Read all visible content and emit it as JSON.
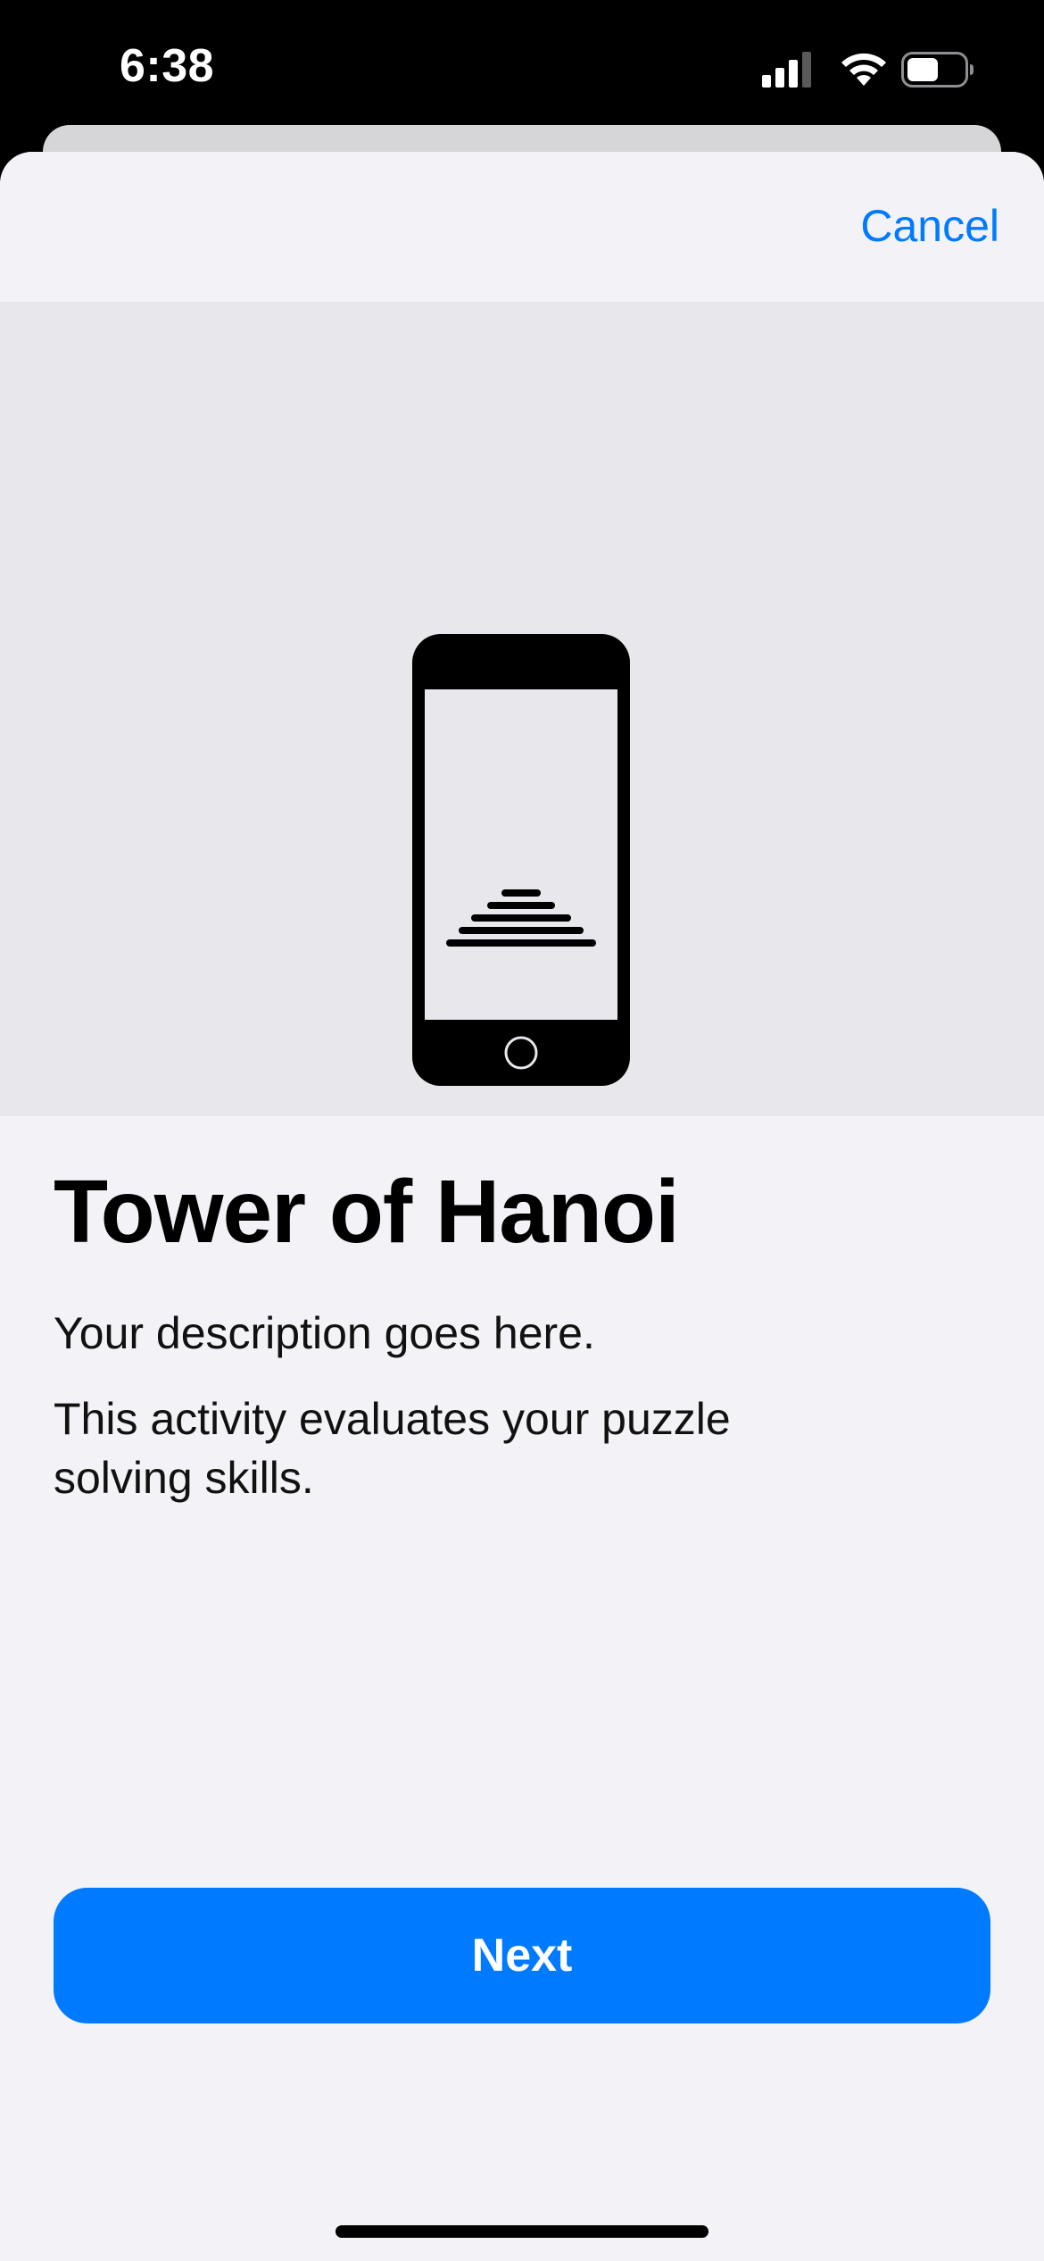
{
  "status_bar": {
    "time": "6:38"
  },
  "nav": {
    "cancel_label": "Cancel"
  },
  "hero": {
    "illustration_icon": "phone-tower-of-hanoi-icon"
  },
  "content": {
    "title": "Tower of Hanoi",
    "description": "Your description goes here.",
    "detail": "This activity evaluates your puzzle solving skills."
  },
  "actions": {
    "next_label": "Next"
  },
  "colors": {
    "accent": "#007aff",
    "sheet_background": "#f2f2f7",
    "hero_background": "#e7e7ec"
  }
}
